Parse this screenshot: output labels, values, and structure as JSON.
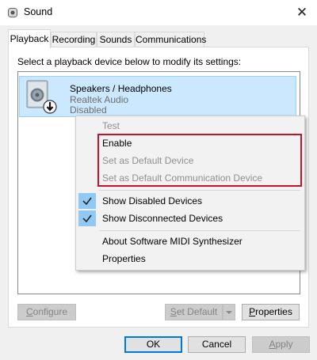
{
  "window": {
    "title": "Sound",
    "close_glyph": "✕"
  },
  "tabs": [
    {
      "label": "Playback"
    },
    {
      "label": "Recording"
    },
    {
      "label": "Sounds"
    },
    {
      "label": "Communications"
    }
  ],
  "instruction": "Select a playback device below to modify its settings:",
  "device": {
    "name": "Speakers / Headphones",
    "driver": "Realtek Audio",
    "status": "Disabled",
    "icon": "speaker-icon",
    "overlay_icon": "disabled-arrow-icon"
  },
  "context_menu": {
    "items": [
      {
        "label": "Test"
      },
      {
        "label": "Enable"
      },
      {
        "label": "Set as Default Device"
      },
      {
        "label": "Set as Default Communication Device"
      },
      {
        "label": "Show Disabled Devices"
      },
      {
        "label": "Show Disconnected Devices"
      },
      {
        "label": "About Software MIDI Synthesizer"
      },
      {
        "label": "Properties"
      }
    ]
  },
  "panel_buttons": {
    "configure_acc": "C",
    "configure_rest": "onfigure",
    "set_default_acc": "S",
    "set_default_rest": "et Default",
    "properties_acc": "P",
    "properties_rest": "roperties"
  },
  "dialog_buttons": {
    "ok": "OK",
    "cancel": "Cancel",
    "apply_acc": "A",
    "apply_rest": "pply"
  },
  "colors": {
    "selection": "#cce8ff",
    "highlight_box": "#c8102e",
    "check_bg": "#90c8f6"
  }
}
